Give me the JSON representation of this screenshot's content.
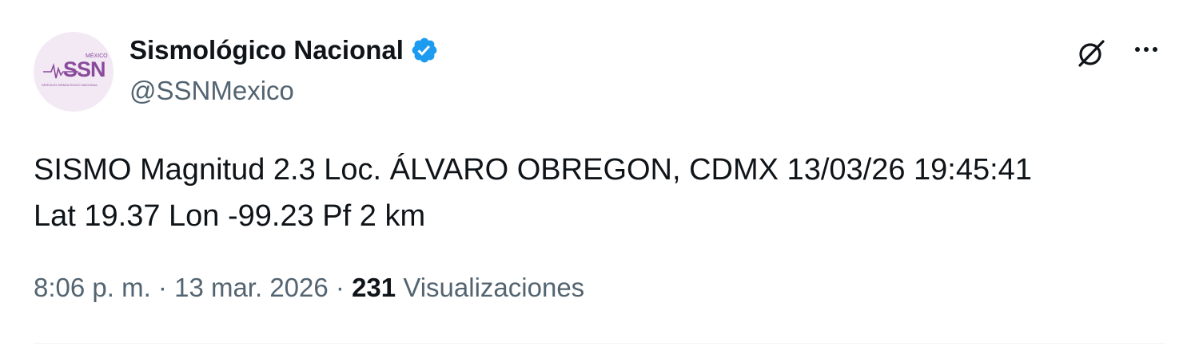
{
  "author": {
    "display_name": "Sismológico Nacional",
    "handle": "@SSNMexico",
    "verified": true,
    "verified_color": "#1d9bf0",
    "avatar": {
      "icon": "ssn-logo",
      "logo_text": "SSN",
      "logo_country": "MÉXICO",
      "logo_subtitle": "SERVICIO SISMOLÓGICO NACIONAL",
      "accent_color": "#8a4a9c"
    }
  },
  "actions": {
    "grok_icon": "grok-icon",
    "more_icon": "more-dots-icon"
  },
  "tweet": {
    "text_line1": "SISMO Magnitud 2.3 Loc. ÁLVARO OBREGON, CDMX 13/03/26 19:45:41",
    "text_line2": "Lat 19.37 Lon -99.23 Pf 2 km"
  },
  "meta": {
    "time": "8:06 p. m.",
    "separator": "·",
    "date": "13 mar. 2026",
    "views_count": "231",
    "views_label": "Visualizaciones"
  }
}
